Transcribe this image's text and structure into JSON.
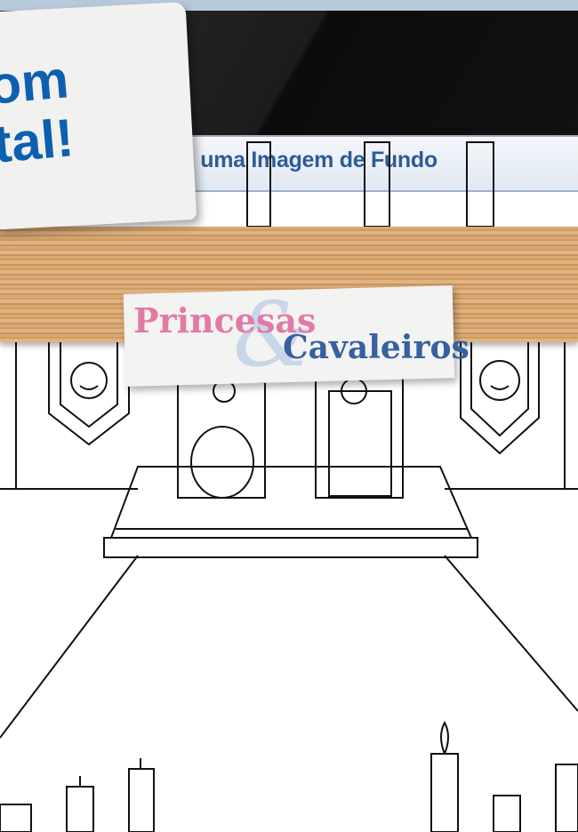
{
  "header": {
    "subtitle": "e uma Imagem de Fundo"
  },
  "promo_note": {
    "line1": "om",
    "line2": "tal!"
  },
  "logo": {
    "word1": "Princesas",
    "ampersand": "&",
    "word2": "Cavaleiros"
  },
  "colors": {
    "accent_blue": "#0d5fb0",
    "logo_pink": "#e27aa6",
    "logo_blue": "#36609f",
    "wood": "#d9a873"
  }
}
